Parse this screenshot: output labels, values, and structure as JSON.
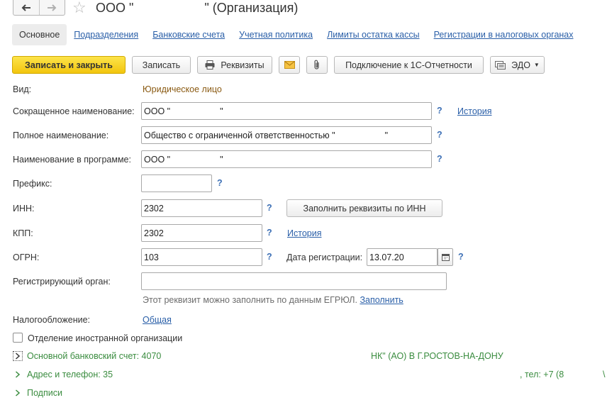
{
  "window": {
    "title": "ООО \"                    \" (Организация)"
  },
  "nav": {
    "back_icon": "arrow-left-icon",
    "forward_icon": "arrow-right-icon",
    "favorite_icon": "star-icon"
  },
  "tabs": [
    {
      "label": "Основное",
      "active": true
    },
    {
      "label": "Подразделения",
      "active": false
    },
    {
      "label": "Банковские счета",
      "active": false
    },
    {
      "label": "Учетная политика",
      "active": false
    },
    {
      "label": "Лимиты остатка кассы",
      "active": false
    },
    {
      "label": "Регистрации в налоговых органах",
      "active": false
    }
  ],
  "toolbar": {
    "save_close": "Записать и закрыть",
    "save": "Записать",
    "requisites": "Реквизиты",
    "mail_icon": "envelope-icon",
    "attach_icon": "paperclip-icon",
    "connect_reporting": "Подключение к 1С-Отчетности",
    "edo": "ЭДО"
  },
  "form": {
    "type_label": "Вид:",
    "type_value": "Юридическое лицо",
    "short_name_label": "Сокращенное наименование:",
    "short_name_value": "ООО \"",
    "short_name_tail": "\"",
    "full_name_label": "Полное наименование:",
    "full_name_value": "Общество с ограниченной ответственностью \"",
    "full_name_tail": "\"",
    "program_name_label": "Наименование в программе:",
    "program_name_value": "ООО \"",
    "program_name_tail": "\"",
    "prefix_label": "Префикс:",
    "prefix_value": "",
    "inn_label": "ИНН:",
    "inn_value": "2302",
    "fill_by_inn": "Заполнить реквизиты по ИНН",
    "kpp_label": "КПП:",
    "kpp_value": "2302",
    "ogrn_label": "ОГРН:",
    "ogrn_value": "103",
    "reg_date_label": "Дата регистрации:",
    "reg_date_value": "13.07.20",
    "reg_authority_label": "Регистрирующий орган:",
    "reg_authority_value": "",
    "egrul_hint": "Этот реквизит можно заполнить по данным ЕГРЮЛ.",
    "egrul_fill": "Заполнить",
    "tax_label": "Налогообложение:",
    "tax_value": "Общая",
    "foreign_branch": "Отделение иностранной организации",
    "history": "История",
    "help": "?"
  },
  "sections": {
    "bank_account": "Основной банковский счет: 4070",
    "bank_name": "НК\" (АО) В Г.РОСТОВ-НА-ДОНУ",
    "address": "Адрес и телефон: 35",
    "address_tail": ", тел: +7 (8",
    "address_edge": "\\",
    "signatures": "Подписи"
  }
}
